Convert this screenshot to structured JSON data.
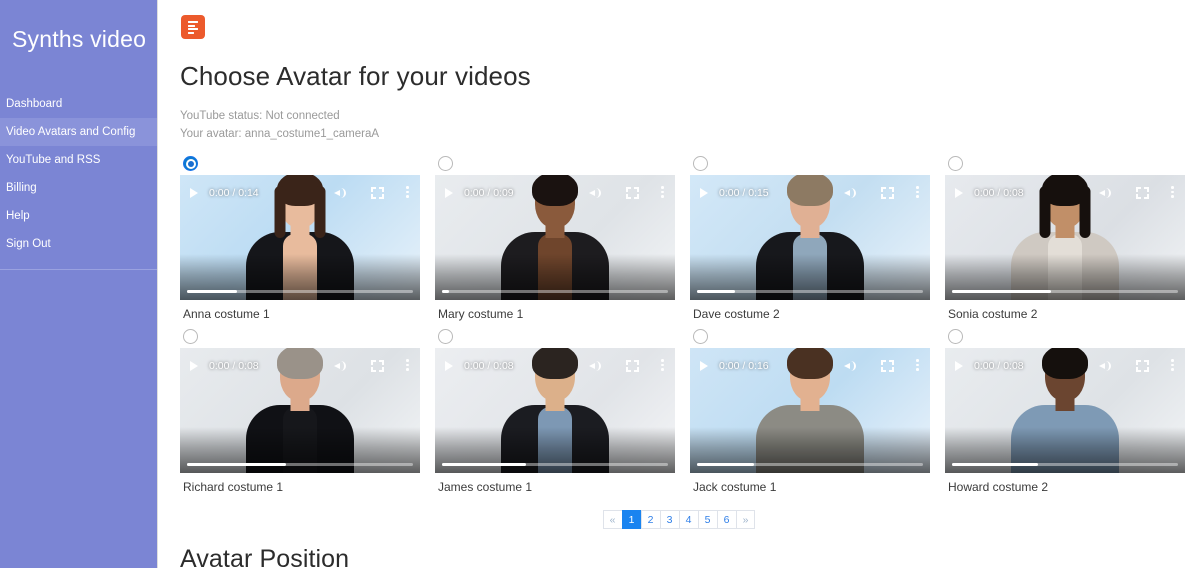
{
  "sidebar": {
    "brand": "Synths video",
    "items": [
      {
        "label": "Dashboard",
        "active": false
      },
      {
        "label": "Video Avatars and Config",
        "active": true
      },
      {
        "label": "YouTube and RSS",
        "active": false
      },
      {
        "label": "Billing",
        "active": false
      },
      {
        "label": "Help",
        "active": false
      },
      {
        "label": "Sign Out",
        "active": false
      }
    ],
    "background_color": "#7b85d4",
    "active_color": "#8a93da"
  },
  "header": {
    "logo_icon": "list-logo-icon",
    "logo_color": "#ec5a2c"
  },
  "main": {
    "page_title": "Choose Avatar for your videos",
    "youtube_status": "YouTube status: Not connected",
    "your_avatar": "Your avatar: anna_costume1_cameraA",
    "section_title": "Avatar Position"
  },
  "avatars": [
    {
      "label": "Anna costume 1",
      "time": "0:00 / 0:14",
      "selected": true,
      "progress": 22,
      "bg": "linear-gradient(135deg,#cfe6f7 0%,#bcdcf3 45%,#e8f2fa 100%)",
      "skin": "#e8bb9d",
      "hair": "#3a2419",
      "cloth": "#15161a",
      "shirt": "#e8bb9d",
      "has_long_hair": true
    },
    {
      "label": "Mary costume 1",
      "time": "0:00 / 0:09",
      "selected": false,
      "progress": 3,
      "bg": "linear-gradient(135deg,#e9ecef 0%,#dfe3e7 60%,#f2f4f6 100%)",
      "skin": "#8a5a3c",
      "hair": "#1a1210",
      "cloth": "#1d1c1f",
      "shirt": "#6f452c",
      "has_long_hair": false
    },
    {
      "label": "Dave costume 2",
      "time": "0:00 / 0:15",
      "selected": false,
      "progress": 17,
      "bg": "linear-gradient(135deg,#d3e8f8 0%,#c3def1 50%,#eaf3fb 100%)",
      "skin": "#e0b094",
      "hair": "#8d7a63",
      "cloth": "#17181c",
      "shirt": "#8fa7bb",
      "has_long_hair": false
    },
    {
      "label": "Sonia costume 2",
      "time": "0:00 / 0:08",
      "selected": false,
      "progress": 44,
      "bg": "linear-gradient(135deg,#e7eaee 0%,#dbdfe4 60%,#f1f3f5 100%)",
      "skin": "#c18f68",
      "hair": "#16100d",
      "cloth": "#cfc9c2",
      "shirt": "#e3ded7",
      "has_long_hair": true
    },
    {
      "label": "Richard costume 1",
      "time": "0:00 / 0:08",
      "selected": false,
      "progress": 44,
      "bg": "linear-gradient(135deg,#e8ebee 0%,#dde1e5 60%,#f2f4f6 100%)",
      "skin": "#dca98b",
      "hair": "#9a9289",
      "cloth": "#101115",
      "shirt": "#16171b",
      "has_long_hair": false
    },
    {
      "label": "James costume 1",
      "time": "0:00 / 0:08",
      "selected": false,
      "progress": 37,
      "bg": "linear-gradient(135deg,#eceef1 0%,#e1e4e8 60%,#f4f5f7 100%)",
      "skin": "#dcb08a",
      "hair": "#2b2420",
      "cloth": "#1b1c21",
      "shirt": "#7d98b4",
      "has_long_hair": false
    },
    {
      "label": "Jack costume 1",
      "time": "0:00 / 0:16",
      "selected": false,
      "progress": 25,
      "bg": "linear-gradient(135deg,#cfe5f6 0%,#bddcf2 50%,#e9f2fb 100%)",
      "skin": "#e2b190",
      "hair": "#4a3122",
      "cloth": "#8c8b84",
      "shirt": "#8c8b84",
      "has_long_hair": false
    },
    {
      "label": "Howard costume 2",
      "time": "0:00 / 0:08",
      "selected": false,
      "progress": 38,
      "bg": "linear-gradient(135deg,#e9ecef 0%,#dee2e6 60%,#f2f4f6 100%)",
      "skin": "#6b4530",
      "hair": "#15100d",
      "cloth": "#7e9ab5",
      "shirt": "#7e9ab5",
      "has_long_hair": false
    }
  ],
  "pagination": {
    "prev_label": "«",
    "next_label": "»",
    "pages": [
      "1",
      "2",
      "3",
      "4",
      "5",
      "6"
    ],
    "active_page": "1",
    "active_color": "#1a84f0"
  }
}
